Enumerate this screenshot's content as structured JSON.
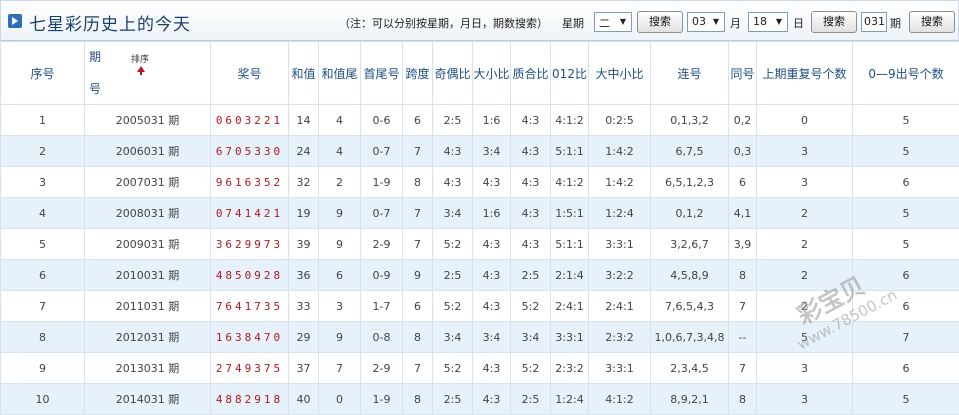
{
  "header": {
    "title": "七星彩历史上的今天",
    "note": "（注：可以分别按星期，月日，期数搜索）",
    "week_label": "星期",
    "week_value": "二",
    "search_label": "搜索",
    "month_value": "03",
    "month_label": "月",
    "day_value": "18",
    "day_label": "日",
    "issue_value": "031",
    "issue_label": "期"
  },
  "table": {
    "columns": {
      "seq": "序号",
      "issue_1": "期",
      "issue_2": "号",
      "sort": "排序",
      "award": "奖号",
      "sum": "和值",
      "sum_tail": "和值尾",
      "first_last": "首尾号",
      "span": "跨度",
      "odd_even": "奇偶比",
      "big_small": "大小比",
      "prime_comp": "质合比",
      "ratio_012": "012比",
      "big_mid_small": "大中小比",
      "consecutive": "连号",
      "same": "同号",
      "repeat_prev": "上期重复号个数",
      "count_0_9": "0—9出号个数"
    },
    "rows": [
      {
        "seq": "1",
        "issue": "2005031 期",
        "award": "0603221",
        "sum": "14",
        "sum_tail": "4",
        "first_last": "0-6",
        "span": "6",
        "odd_even": "2:5",
        "big_small": "1:6",
        "prime_comp": "4:3",
        "ratio_012": "4:1:2",
        "big_mid_small": "0:2:5",
        "consecutive": "0,1,3,2",
        "same": "0,2",
        "repeat_prev": "0",
        "count_0_9": "5"
      },
      {
        "seq": "2",
        "issue": "2006031 期",
        "award": "6705330",
        "sum": "24",
        "sum_tail": "4",
        "first_last": "0-7",
        "span": "7",
        "odd_even": "4:3",
        "big_small": "3:4",
        "prime_comp": "4:3",
        "ratio_012": "5:1:1",
        "big_mid_small": "1:4:2",
        "consecutive": "6,7,5",
        "same": "0,3",
        "repeat_prev": "3",
        "count_0_9": "5"
      },
      {
        "seq": "3",
        "issue": "2007031 期",
        "award": "9616352",
        "sum": "32",
        "sum_tail": "2",
        "first_last": "1-9",
        "span": "8",
        "odd_even": "4:3",
        "big_small": "4:3",
        "prime_comp": "4:3",
        "ratio_012": "4:1:2",
        "big_mid_small": "1:4:2",
        "consecutive": "6,5,1,2,3",
        "same": "6",
        "repeat_prev": "3",
        "count_0_9": "6"
      },
      {
        "seq": "4",
        "issue": "2008031 期",
        "award": "0741421",
        "sum": "19",
        "sum_tail": "9",
        "first_last": "0-7",
        "span": "7",
        "odd_even": "3:4",
        "big_small": "1:6",
        "prime_comp": "4:3",
        "ratio_012": "1:5:1",
        "big_mid_small": "1:2:4",
        "consecutive": "0,1,2",
        "same": "4,1",
        "repeat_prev": "2",
        "count_0_9": "5"
      },
      {
        "seq": "5",
        "issue": "2009031 期",
        "award": "3629973",
        "sum": "39",
        "sum_tail": "9",
        "first_last": "2-9",
        "span": "7",
        "odd_even": "5:2",
        "big_small": "4:3",
        "prime_comp": "4:3",
        "ratio_012": "5:1:1",
        "big_mid_small": "3:3:1",
        "consecutive": "3,2,6,7",
        "same": "3,9",
        "repeat_prev": "2",
        "count_0_9": "5"
      },
      {
        "seq": "6",
        "issue": "2010031 期",
        "award": "4850928",
        "sum": "36",
        "sum_tail": "6",
        "first_last": "0-9",
        "span": "9",
        "odd_even": "2:5",
        "big_small": "4:3",
        "prime_comp": "2:5",
        "ratio_012": "2:1:4",
        "big_mid_small": "3:2:2",
        "consecutive": "4,5,8,9",
        "same": "8",
        "repeat_prev": "2",
        "count_0_9": "6"
      },
      {
        "seq": "7",
        "issue": "2011031 期",
        "award": "7641735",
        "sum": "33",
        "sum_tail": "3",
        "first_last": "1-7",
        "span": "6",
        "odd_even": "5:2",
        "big_small": "4:3",
        "prime_comp": "5:2",
        "ratio_012": "2:4:1",
        "big_mid_small": "2:4:1",
        "consecutive": "7,6,5,4,3",
        "same": "7",
        "repeat_prev": "2",
        "count_0_9": "6"
      },
      {
        "seq": "8",
        "issue": "2012031 期",
        "award": "1638470",
        "sum": "29",
        "sum_tail": "9",
        "first_last": "0-8",
        "span": "8",
        "odd_even": "3:4",
        "big_small": "3:4",
        "prime_comp": "3:4",
        "ratio_012": "3:3:1",
        "big_mid_small": "2:3:2",
        "consecutive": "1,0,6,7,3,4,8",
        "same": "--",
        "repeat_prev": "5",
        "count_0_9": "7"
      },
      {
        "seq": "9",
        "issue": "2013031 期",
        "award": "2749375",
        "sum": "37",
        "sum_tail": "7",
        "first_last": "2-9",
        "span": "7",
        "odd_even": "5:2",
        "big_small": "4:3",
        "prime_comp": "5:2",
        "ratio_012": "2:3:2",
        "big_mid_small": "3:3:1",
        "consecutive": "2,3,4,5",
        "same": "7",
        "repeat_prev": "3",
        "count_0_9": "6"
      },
      {
        "seq": "10",
        "issue": "2014031 期",
        "award": "4882918",
        "sum": "40",
        "sum_tail": "0",
        "first_last": "1-9",
        "span": "8",
        "odd_even": "2:5",
        "big_small": "4:3",
        "prime_comp": "2:5",
        "ratio_012": "1:2:4",
        "big_mid_small": "4:1:2",
        "consecutive": "8,9,2,1",
        "same": "8",
        "repeat_prev": "3",
        "count_0_9": "5"
      }
    ]
  },
  "watermark": {
    "brand": "彩宝贝",
    "url": "www.78500.cn"
  }
}
